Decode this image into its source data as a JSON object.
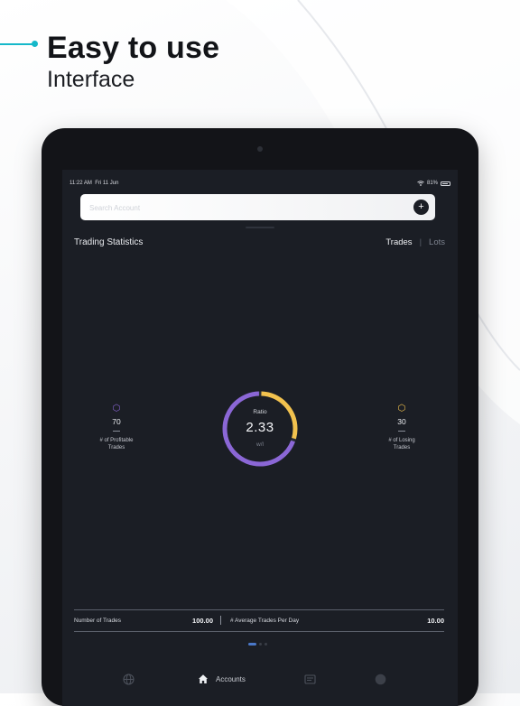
{
  "promo": {
    "title": "Easy to use",
    "subtitle": "Interface"
  },
  "status_bar": {
    "time": "11:22 AM",
    "date": "Fri 11 Jun",
    "battery": "81%"
  },
  "search": {
    "placeholder": "Search Account",
    "add_label": "+"
  },
  "stats": {
    "title": "Trading Statistics",
    "toggle": {
      "option_trades": "Trades",
      "separator": "|",
      "option_lots": "Lots",
      "selected": "Trades"
    },
    "profitable": {
      "value": "70",
      "label_line1": "# of Profitable",
      "label_line2": "Trades",
      "color": "#8b67d6"
    },
    "losing": {
      "value": "30",
      "label_line1": "# of Losing",
      "label_line2": "Trades",
      "color": "#f2c24e"
    },
    "ratio": {
      "label": "Ratio",
      "value": "2.33",
      "unit": "w/l",
      "profit_fraction": 0.7
    }
  },
  "summary": {
    "num_trades_label": "Number of Trades",
    "num_trades_value": "100.00",
    "avg_trades_label": "# Average Trades Per Day",
    "avg_trades_value": "10.00"
  },
  "pager": {
    "pages": 3,
    "current": 1
  },
  "bottom_nav": {
    "items": [
      {
        "icon": "globe-icon",
        "label": ""
      },
      {
        "icon": "home-icon",
        "label": "Accounts"
      },
      {
        "icon": "news-icon",
        "label": ""
      },
      {
        "icon": "profile-icon",
        "label": ""
      }
    ]
  }
}
